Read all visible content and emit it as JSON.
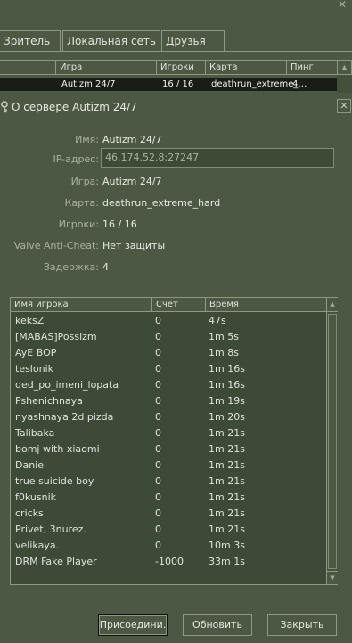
{
  "window": {
    "close_glyph": "✕"
  },
  "tabs": [
    {
      "label": "Зритель"
    },
    {
      "label": "Локальная сеть"
    },
    {
      "label": "Друзья"
    }
  ],
  "server_list": {
    "columns": [
      "Игра",
      "Игроки",
      "Карта",
      "Пинг"
    ],
    "selected_row": {
      "game": "Autizm 24/7",
      "players": "16 / 16",
      "map": "deathrun_extreme_…",
      "ping": "4"
    }
  },
  "dialog": {
    "title": "О сервере Autizm 24/7",
    "close_glyph": "✕",
    "info": {
      "name_label": "Имя:",
      "name_value": "Autizm 24/7",
      "ip_label": "IP-адрес:",
      "ip_value": "46.174.52.8:27247",
      "game_label": "Игра:",
      "game_value": "Autizm 24/7",
      "map_label": "Карта:",
      "map_value": "deathrun_extreme_hard",
      "players_label": "Игроки:",
      "players_value": "16 / 16",
      "vac_label": "Valve Anti-Cheat:",
      "vac_value": "Нет защиты",
      "latency_label": "Задержка:",
      "latency_value": "4"
    },
    "players_table": {
      "columns": [
        "Имя игрока",
        "Счет",
        "Время"
      ],
      "rows": [
        {
          "name": "keksZ",
          "score": "0",
          "time": "47s"
        },
        {
          "name": "[MABAS]Possizm",
          "score": "0",
          "time": "1m 5s"
        },
        {
          "name": "AyE BOP",
          "score": "0",
          "time": "1m 8s"
        },
        {
          "name": "teslonik",
          "score": "0",
          "time": "1m 16s"
        },
        {
          "name": "ded_po_imeni_lopata",
          "score": "0",
          "time": "1m 16s"
        },
        {
          "name": "Pshenichnaya",
          "score": "0",
          "time": "1m 19s"
        },
        {
          "name": "nyashnaya 2d pizda",
          "score": "0",
          "time": "1m 20s"
        },
        {
          "name": "Talibaka",
          "score": "0",
          "time": "1m 21s"
        },
        {
          "name": "bomj with xiaomi",
          "score": "0",
          "time": "1m 21s"
        },
        {
          "name": "Daniel",
          "score": "0",
          "time": "1m 21s"
        },
        {
          "name": "true suicide boy",
          "score": "0",
          "time": "1m 21s"
        },
        {
          "name": "f0kusnik",
          "score": "0",
          "time": "1m 21s"
        },
        {
          "name": "cricks",
          "score": "0",
          "time": "1m 21s"
        },
        {
          "name": "Privet, 3nurez.",
          "score": "0",
          "time": "1m 21s"
        },
        {
          "name": "velikaya.",
          "score": "0",
          "time": "10m 3s"
        },
        {
          "name": "DRM Fake Player",
          "score": "-1000",
          "time": "33m 1s"
        }
      ]
    },
    "buttons": {
      "join": "Присоедини.",
      "refresh": "Обновить",
      "close": "Закрыть"
    }
  },
  "icons": {
    "key": "key-icon",
    "scroll_up": "▲",
    "scroll_down": "▼"
  },
  "colors": {
    "background": "#4c5844",
    "border": "#8c9985",
    "selected_row": "#1a1c17",
    "list_bg": "#3e4a38"
  }
}
